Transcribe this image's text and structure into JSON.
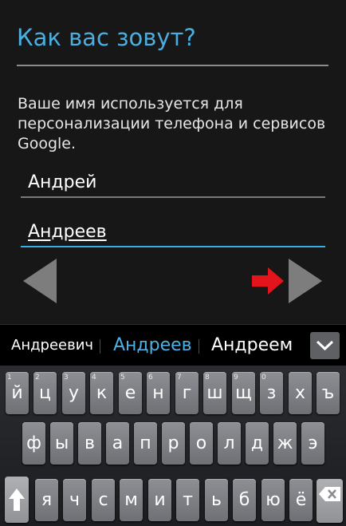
{
  "setup": {
    "title": "Как вас зовут?",
    "description": "Ваше имя используется для персонализации телефона и сервисов Google.",
    "first_name": "Андрей",
    "last_name": "Андреев"
  },
  "colors": {
    "accent": "#34aee3",
    "arrow_hint": "#e3141b",
    "background": "#171717"
  },
  "suggestions": [
    "Андреевич",
    "Андреев",
    "Андреем"
  ],
  "keyboard": {
    "row1": [
      {
        "ch": "й",
        "hint": "1"
      },
      {
        "ch": "ц",
        "hint": "2"
      },
      {
        "ch": "у",
        "hint": "3"
      },
      {
        "ch": "к",
        "hint": "4"
      },
      {
        "ch": "е",
        "hint": "5"
      },
      {
        "ch": "н",
        "hint": "6"
      },
      {
        "ch": "г",
        "hint": "7"
      },
      {
        "ch": "ш",
        "hint": "8"
      },
      {
        "ch": "щ",
        "hint": "9"
      },
      {
        "ch": "з",
        "hint": "0"
      },
      {
        "ch": "х",
        "hint": ""
      },
      {
        "ch": "ъ",
        "hint": ""
      }
    ],
    "row2": [
      "ф",
      "ы",
      "в",
      "а",
      "п",
      "р",
      "о",
      "л",
      "д",
      "ж",
      "э"
    ],
    "row3": [
      "я",
      "ч",
      "с",
      "м",
      "и",
      "т",
      "ь",
      "б",
      "ю",
      "ё"
    ],
    "icons": {
      "shift": "shift-arrow-icon",
      "backspace": "backspace-icon",
      "expand": "chevron-down-icon",
      "back": "triangle-left-icon",
      "next": "triangle-right-icon"
    }
  }
}
